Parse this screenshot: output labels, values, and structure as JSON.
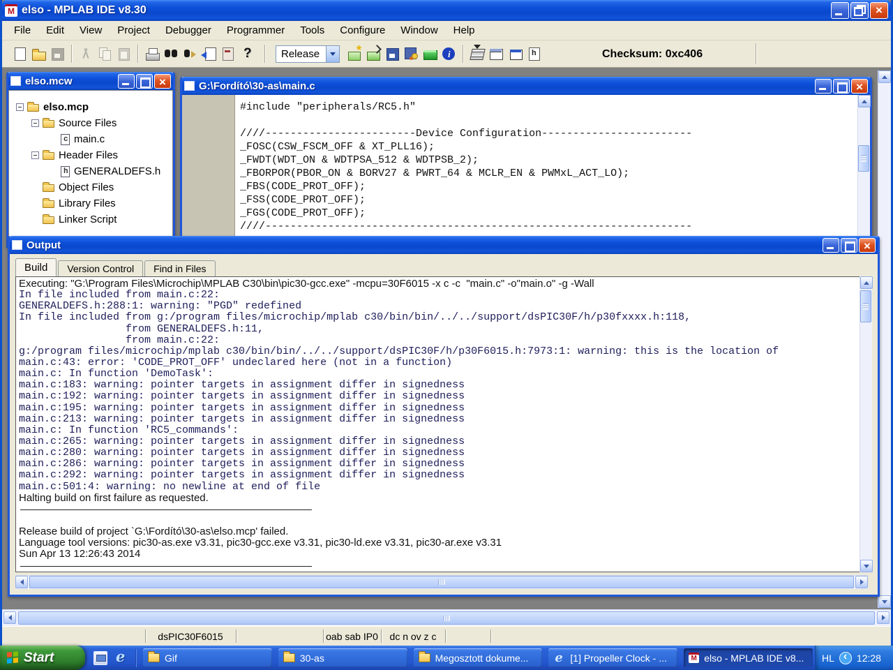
{
  "titlebar": {
    "title": "elso - MPLAB IDE v8.30"
  },
  "menu": {
    "items": [
      {
        "name": "menu-file",
        "label": "File"
      },
      {
        "name": "menu-edit",
        "label": "Edit"
      },
      {
        "name": "menu-view",
        "label": "View"
      },
      {
        "name": "menu-project",
        "label": "Project"
      },
      {
        "name": "menu-debugger",
        "label": "Debugger"
      },
      {
        "name": "menu-programmer",
        "label": "Programmer"
      },
      {
        "name": "menu-tools",
        "label": "Tools"
      },
      {
        "name": "menu-configure",
        "label": "Configure"
      },
      {
        "name": "menu-window",
        "label": "Window"
      },
      {
        "name": "menu-help",
        "label": "Help"
      }
    ]
  },
  "toolbar": {
    "release": "Release",
    "checksum": "Checksum: 0xc406",
    "group1": [
      {
        "name": "new-file-icon",
        "icon": "doc-new"
      },
      {
        "name": "open-file-icon",
        "icon": "folder-open"
      },
      {
        "name": "save-file-icon",
        "icon": "floppy",
        "disabled": true
      }
    ],
    "group2": [
      {
        "name": "cut-icon",
        "icon": "cut",
        "disabled": true
      },
      {
        "name": "copy-icon",
        "icon": "copy",
        "disabled": true
      },
      {
        "name": "paste-icon",
        "icon": "paste",
        "disabled": true
      }
    ],
    "group3": [
      {
        "name": "print-icon",
        "icon": "printer"
      },
      {
        "name": "find-icon",
        "icon": "binoculars"
      },
      {
        "name": "find-next-icon",
        "icon": "find-next"
      },
      {
        "name": "goto-icon",
        "icon": "goto"
      },
      {
        "name": "properties-icon",
        "icon": "properties"
      },
      {
        "name": "help-icon",
        "icon": "help"
      }
    ],
    "group4": [
      {
        "name": "new-project-icon",
        "icon": "new-project"
      },
      {
        "name": "open-workspace-icon",
        "icon": "open-workspace"
      },
      {
        "name": "save-workspace-icon",
        "icon": "save-workspace"
      },
      {
        "name": "build-all-icon",
        "icon": "build-all"
      },
      {
        "name": "make-icon",
        "icon": "make"
      },
      {
        "name": "about-icon",
        "icon": "about"
      }
    ],
    "group5": [
      {
        "name": "stack-icon",
        "icon": "stack"
      },
      {
        "name": "stopwatch-icon",
        "icon": "stopwatch"
      },
      {
        "name": "memory-window-icon",
        "icon": "memory-window"
      },
      {
        "name": "file-registers-icon",
        "icon": "file-registers"
      }
    ]
  },
  "project": {
    "title": "elso.mcw",
    "tree": [
      {
        "name": "tree-item-elso-mcp",
        "label": "elso.mcp",
        "icon": "folder",
        "level": 0,
        "toggle": "minus",
        "bold": true
      },
      {
        "name": "tree-item-source-files",
        "label": "Source Files",
        "icon": "folder",
        "level": 1,
        "toggle": "minus"
      },
      {
        "name": "tree-item-main-c",
        "label": "main.c",
        "icon": "file-c",
        "level": 2
      },
      {
        "name": "tree-item-header-files",
        "label": "Header Files",
        "icon": "folder",
        "level": 1,
        "toggle": "minus"
      },
      {
        "name": "tree-item-generaldefs-h",
        "label": "GENERALDEFS.h",
        "icon": "file-h",
        "level": 2
      },
      {
        "name": "tree-item-object-files",
        "label": "Object Files",
        "icon": "folder",
        "level": 1
      },
      {
        "name": "tree-item-library-files",
        "label": "Library Files",
        "icon": "folder",
        "level": 1
      },
      {
        "name": "tree-item-linker-script",
        "label": "Linker Script",
        "icon": "folder",
        "level": 1
      }
    ]
  },
  "editor": {
    "title": "G:\\Fordító\\30-as\\main.c",
    "lines": [
      {
        "text": "#include \"peripherals/RC5.h\""
      },
      {
        "text": ""
      },
      {
        "text": "////------------------------Device Configuration------------------------"
      },
      {
        "text": "_FOSC(CSW_FSCM_OFF & XT_PLL16);"
      },
      {
        "text": "_FWDT(WDT_ON & WDTPSA_512 & WDTPSB_2);"
      },
      {
        "text": "_FBORPOR(PBOR_ON & BORV27 & PWRT_64 & MCLR_EN & PWMxL_ACT_LO);"
      },
      {
        "text": "_FBS(CODE_PROT_OFF);"
      },
      {
        "text": "_FSS(CODE_PROT_OFF);"
      },
      {
        "text": "_FGS(CODE_PROT_OFF);"
      },
      {
        "text": "////--------------------------------------------------------------------"
      }
    ]
  },
  "output": {
    "title": "Output",
    "tabs": [
      {
        "name": "tab-build",
        "label": "Build",
        "active": true
      },
      {
        "name": "tab-version-control",
        "label": "Version Control"
      },
      {
        "name": "tab-find-in-files",
        "label": "Find in Files"
      }
    ],
    "lines": [
      {
        "style": "sans",
        "text": "Executing: \"G:\\Program Files\\Microchip\\MPLAB C30\\bin\\pic30-gcc.exe\" -mcpu=30F6015 -x c -c  \"main.c\" -o\"main.o\" -g -Wall"
      },
      {
        "style": "mono",
        "text": "In file included from main.c:22:"
      },
      {
        "style": "mono",
        "text": "GENERALDEFS.h:288:1: warning: \"PGD\" redefined"
      },
      {
        "style": "mono",
        "text": "In file included from g:/program files/microchip/mplab c30/bin/bin/../../support/dsPIC30F/h/p30fxxxx.h:118,"
      },
      {
        "style": "mono",
        "text": "                 from GENERALDEFS.h:11,"
      },
      {
        "style": "mono",
        "text": "                 from main.c:22:"
      },
      {
        "style": "mono",
        "text": "g:/program files/microchip/mplab c30/bin/bin/../../support/dsPIC30F/h/p30F6015.h:7973:1: warning: this is the location of"
      },
      {
        "style": "mono",
        "text": "main.c:43: error: 'CODE_PROT_OFF' undeclared here (not in a function)"
      },
      {
        "style": "mono",
        "text": "main.c: In function 'DemoTask':"
      },
      {
        "style": "mono",
        "text": "main.c:183: warning: pointer targets in assignment differ in signedness"
      },
      {
        "style": "mono",
        "text": "main.c:192: warning: pointer targets in assignment differ in signedness"
      },
      {
        "style": "mono",
        "text": "main.c:195: warning: pointer targets in assignment differ in signedness"
      },
      {
        "style": "mono",
        "text": "main.c:213: warning: pointer targets in assignment differ in signedness"
      },
      {
        "style": "mono",
        "text": "main.c: In function 'RC5_commands':"
      },
      {
        "style": "mono",
        "text": "main.c:265: warning: pointer targets in assignment differ in signedness"
      },
      {
        "style": "mono",
        "text": "main.c:280: warning: pointer targets in assignment differ in signedness"
      },
      {
        "style": "mono",
        "text": "main.c:286: warning: pointer targets in assignment differ in signedness"
      },
      {
        "style": "mono",
        "text": "main.c:292: warning: pointer targets in assignment differ in signedness"
      },
      {
        "style": "mono",
        "text": "main.c:501:4: warning: no newline at end of file"
      },
      {
        "style": "sans",
        "text": "Halting build on first failure as requested."
      },
      {
        "style": "hr",
        "text": ""
      },
      {
        "style": "blank",
        "text": ""
      },
      {
        "style": "sans",
        "text": "Release build of project `G:\\Fordító\\30-as\\elso.mcp' failed."
      },
      {
        "style": "sans",
        "text": "Language tool versions: pic30-as.exe v3.31, pic30-gcc.exe v3.31, pic30-ld.exe v3.31, pic30-ar.exe v3.31"
      },
      {
        "style": "sans",
        "text": "Sun Apr 13 12:26:43 2014"
      },
      {
        "style": "hr",
        "text": ""
      }
    ]
  },
  "status": {
    "device": "dsPIC30F6015",
    "flags_a": "oab sab IP0",
    "flags_b": "dc n ov z c"
  },
  "taskbar": {
    "start_label": "Start",
    "buttons": [
      {
        "name": "taskbar-button-gif",
        "icon_name": "folder-icon",
        "label": "Gif",
        "icon": "folder"
      },
      {
        "name": "taskbar-button-30-as",
        "icon_name": "folder-icon",
        "label": "30-as",
        "icon": "folder"
      },
      {
        "name": "taskbar-button-megosztott",
        "icon_name": "folder-icon",
        "label": "Megosztott dokume...",
        "icon": "folder"
      },
      {
        "name": "taskbar-button-propeller-clock",
        "icon_name": "ie-icon",
        "label": "[1] Propeller Clock - ...",
        "icon": "ie"
      },
      {
        "name": "taskbar-button-mplab",
        "icon_name": "mplab-icon",
        "label": "elso - MPLAB IDE v8...",
        "icon": "mplab",
        "active": true
      }
    ],
    "tray": {
      "lang": "HL",
      "time": "12:28"
    }
  }
}
